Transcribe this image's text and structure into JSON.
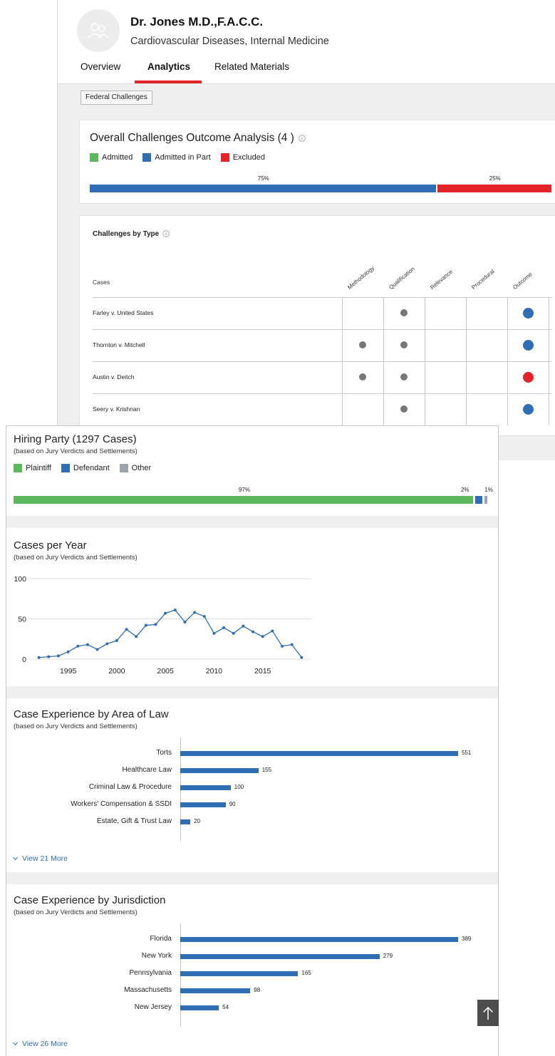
{
  "profile": {
    "name": "Dr. Jones M.D.,F.A.C.C.",
    "specialty": "Cardiovascular Diseases, Internal Medicine",
    "tabs": [
      "Overview",
      "Analytics",
      "Related Materials"
    ],
    "active_tab": "Analytics"
  },
  "filter": {
    "label": "Federal Challenges"
  },
  "outcome": {
    "title": "Overall Challenges Outcome Analysis (4 )",
    "legend": [
      "Admitted",
      "Admitted in Part",
      "Excluded"
    ],
    "colors": {
      "admitted": "#5cb85c",
      "admitted_in_part": "#2f6db5",
      "excluded": "#e2242a"
    },
    "segments": [
      {
        "name": "Admitted in Part",
        "percent": 75,
        "label": "75%"
      },
      {
        "name": "Excluded",
        "percent": 25,
        "label": "25%"
      }
    ]
  },
  "types": {
    "title": "Challenges by Type",
    "cases_label": "Cases",
    "columns": [
      "Methodology",
      "Qualification",
      "Relevance",
      "Procedural",
      "Outcome"
    ],
    "rows": [
      {
        "case": "Farley v. United States",
        "marks": [
          false,
          true,
          false,
          false
        ],
        "outcome": "admitted_in_part"
      },
      {
        "case": "Thornton v. Mitchell",
        "marks": [
          true,
          true,
          false,
          false
        ],
        "outcome": "admitted_in_part"
      },
      {
        "case": "Austin v. Deitch",
        "marks": [
          true,
          true,
          false,
          false
        ],
        "outcome": "excluded"
      },
      {
        "case": "Seery v. Krishnan",
        "marks": [
          false,
          true,
          false,
          false
        ],
        "outcome": "admitted_in_part"
      }
    ]
  },
  "hiring": {
    "title": "Hiring Party (1297 Cases)",
    "subtitle": "(based on Jury Verdicts and Settlements)",
    "legend": [
      "Plaintiff",
      "Defendant",
      "Other"
    ],
    "colors": {
      "plaintiff": "#5cb85c",
      "defendant": "#2f6db5",
      "other": "#9aa5b0"
    },
    "segments": [
      {
        "name": "Plaintiff",
        "percent": 97,
        "label": "97%"
      },
      {
        "name": "Defendant",
        "percent": 2,
        "label": "2%"
      },
      {
        "name": "Other",
        "percent": 1,
        "label": "1%"
      }
    ]
  },
  "cases_per_year": {
    "title": "Cases per Year",
    "subtitle": "(based on Jury Verdicts and Settlements)"
  },
  "area": {
    "title": "Case Experience by Area of Law",
    "subtitle": "(based on Jury Verdicts and Settlements)",
    "view_more": "View 21 More"
  },
  "jurisdiction": {
    "title": "Case Experience by Jurisdiction",
    "subtitle": "(based on Jury Verdicts and Settlements)",
    "view_more": "View 26 More"
  },
  "chart_data": [
    {
      "type": "line",
      "title": "Cases per Year",
      "x": [
        1992,
        1993,
        1994,
        1995,
        1996,
        1997,
        1998,
        1999,
        2000,
        2001,
        2002,
        2003,
        2004,
        2005,
        2006,
        2007,
        2008,
        2009,
        2010,
        2011,
        2012,
        2013,
        2014,
        2015,
        2016,
        2017,
        2018,
        2019
      ],
      "y": [
        2,
        3,
        4,
        9,
        16,
        18,
        12,
        19,
        23,
        37,
        28,
        42,
        43,
        57,
        61,
        46,
        58,
        53,
        32,
        39,
        32,
        41,
        34,
        28,
        35,
        16,
        18,
        2
      ],
      "ylim": [
        0,
        100
      ],
      "yticks": [
        0,
        50,
        100
      ],
      "xticks": [
        1995,
        2000,
        2005,
        2010,
        2015
      ],
      "grid": true,
      "color": "#2f6db5"
    },
    {
      "type": "bar",
      "orientation": "horizontal",
      "title": "Case Experience by Area of Law",
      "categories": [
        "Torts",
        "Healthcare Law",
        "Criminal Law & Procedure",
        "Workers' Compensation & SSDI",
        "Estate, Gift & Trust Law"
      ],
      "values": [
        551,
        155,
        100,
        90,
        20
      ],
      "xlim": [
        0,
        551
      ],
      "color": "#2f6db5"
    },
    {
      "type": "bar",
      "orientation": "horizontal",
      "title": "Case Experience by Jurisdiction",
      "categories": [
        "Florida",
        "New York",
        "Pennsylvania",
        "Massachusetts",
        "New Jersey"
      ],
      "values": [
        389,
        279,
        165,
        98,
        54
      ],
      "xlim": [
        0,
        389
      ],
      "color": "#2f6db5"
    }
  ]
}
